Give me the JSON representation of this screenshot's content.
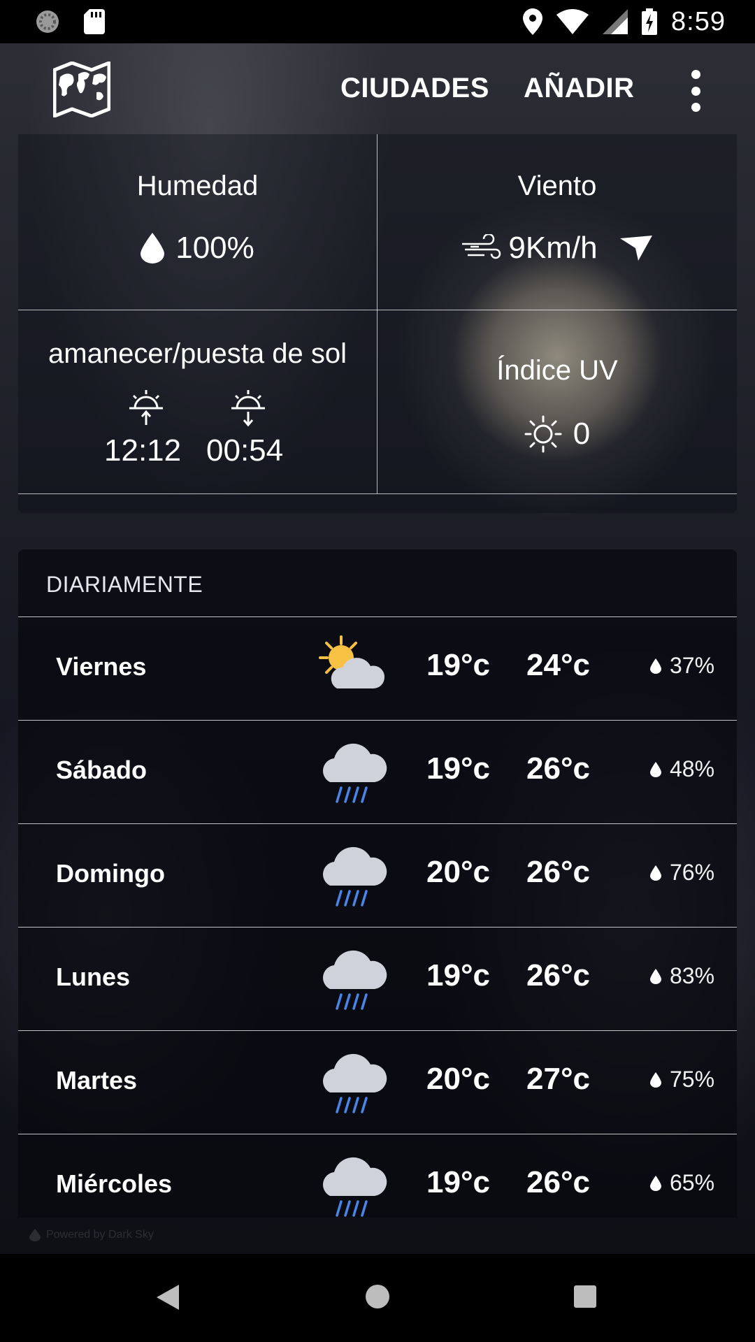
{
  "status_bar": {
    "time": "8:59"
  },
  "app_bar": {
    "cities_label": "CIUDADES",
    "add_label": "AÑADIR"
  },
  "details": {
    "humidity": {
      "title": "Humedad",
      "value": "100%"
    },
    "wind": {
      "title": "Viento",
      "value": "9Km/h"
    },
    "sun": {
      "title": "amanecer/puesta de sol",
      "sunrise": "12:12",
      "sunset": "00:54"
    },
    "uv": {
      "title": "Índice UV",
      "value": "0"
    }
  },
  "daily": {
    "header": "DIARIAMENTE",
    "rows": [
      {
        "day": "Viernes",
        "icon": "partly-cloudy-day-icon",
        "low": "19°c",
        "high": "24°c",
        "rain": "37%"
      },
      {
        "day": "Sábado",
        "icon": "rain-icon",
        "low": "19°c",
        "high": "26°c",
        "rain": "48%"
      },
      {
        "day": "Domingo",
        "icon": "rain-icon",
        "low": "20°c",
        "high": "26°c",
        "rain": "76%"
      },
      {
        "day": "Lunes",
        "icon": "rain-icon",
        "low": "19°c",
        "high": "26°c",
        "rain": "83%"
      },
      {
        "day": "Martes",
        "icon": "rain-icon",
        "low": "20°c",
        "high": "27°c",
        "rain": "75%"
      },
      {
        "day": "Miércoles",
        "icon": "rain-icon",
        "low": "19°c",
        "high": "26°c",
        "rain": "65%"
      }
    ]
  },
  "footer": {
    "powered_by": "Powered by Dark Sky"
  },
  "colors": {
    "sun": "#f7c244",
    "cloud": "#cfd2da",
    "rain": "#4a86e8"
  }
}
